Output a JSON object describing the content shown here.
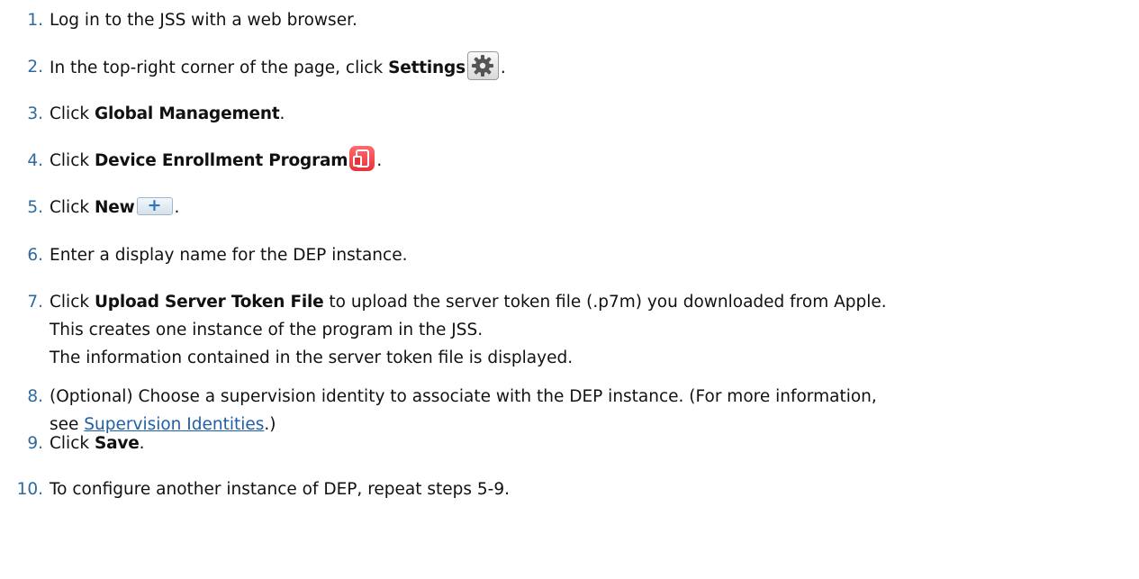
{
  "steps": [
    {
      "num": "1.",
      "segments": [
        {
          "t": "Log in to the JSS with a web browser."
        }
      ]
    },
    {
      "num": "2.",
      "segments": [
        {
          "t": "In the top-right corner of the page, click "
        },
        {
          "t": "Settings",
          "b": true
        },
        {
          "icon": "gear-icon"
        },
        {
          "t": "."
        }
      ]
    },
    {
      "num": "3.",
      "segments": [
        {
          "t": "Click "
        },
        {
          "t": "Global Management",
          "b": true
        },
        {
          "t": "."
        }
      ]
    },
    {
      "num": "4.",
      "segments": [
        {
          "t": "Click "
        },
        {
          "t": "Device Enrollment Program",
          "b": true
        },
        {
          "icon": "device-enrollment-icon"
        },
        {
          "t": "."
        }
      ]
    },
    {
      "num": "5.",
      "segments": [
        {
          "t": "Click "
        },
        {
          "t": "New",
          "b": true
        },
        {
          "icon": "plus-icon"
        },
        {
          "t": "."
        }
      ]
    },
    {
      "num": "6.",
      "segments": [
        {
          "t": "Enter a display name for the DEP instance."
        }
      ]
    },
    {
      "num": "7.",
      "segments": [
        {
          "t": "Click "
        },
        {
          "t": "Upload Server Token File",
          "b": true
        },
        {
          "t": " to upload the server token file (.p7m) you downloaded from Apple."
        }
      ],
      "continuation": [
        "This creates one instance of the program in the JSS.",
        "The information contained in the server token file is displayed."
      ]
    },
    {
      "num": "8.",
      "segments": [
        {
          "t": "(Optional) Choose a supervision identity to associate with the DEP instance. (For more information,"
        }
      ],
      "continuation_segments": [
        {
          "t": "see "
        },
        {
          "t": "Supervision Identities",
          "link": true
        },
        {
          "t": ".)"
        }
      ]
    },
    {
      "num": "9.",
      "segments": [
        {
          "t": "Click "
        },
        {
          "t": "Save",
          "b": true
        },
        {
          "t": "."
        }
      ]
    },
    {
      "num": "10.",
      "segments": [
        {
          "t": "To configure another instance of DEP, repeat steps 5-9."
        }
      ]
    }
  ],
  "colors": {
    "number": "#2f6a9e",
    "link": "#1f5fa8",
    "text": "#111111",
    "dep_icon": "#e8323a"
  }
}
